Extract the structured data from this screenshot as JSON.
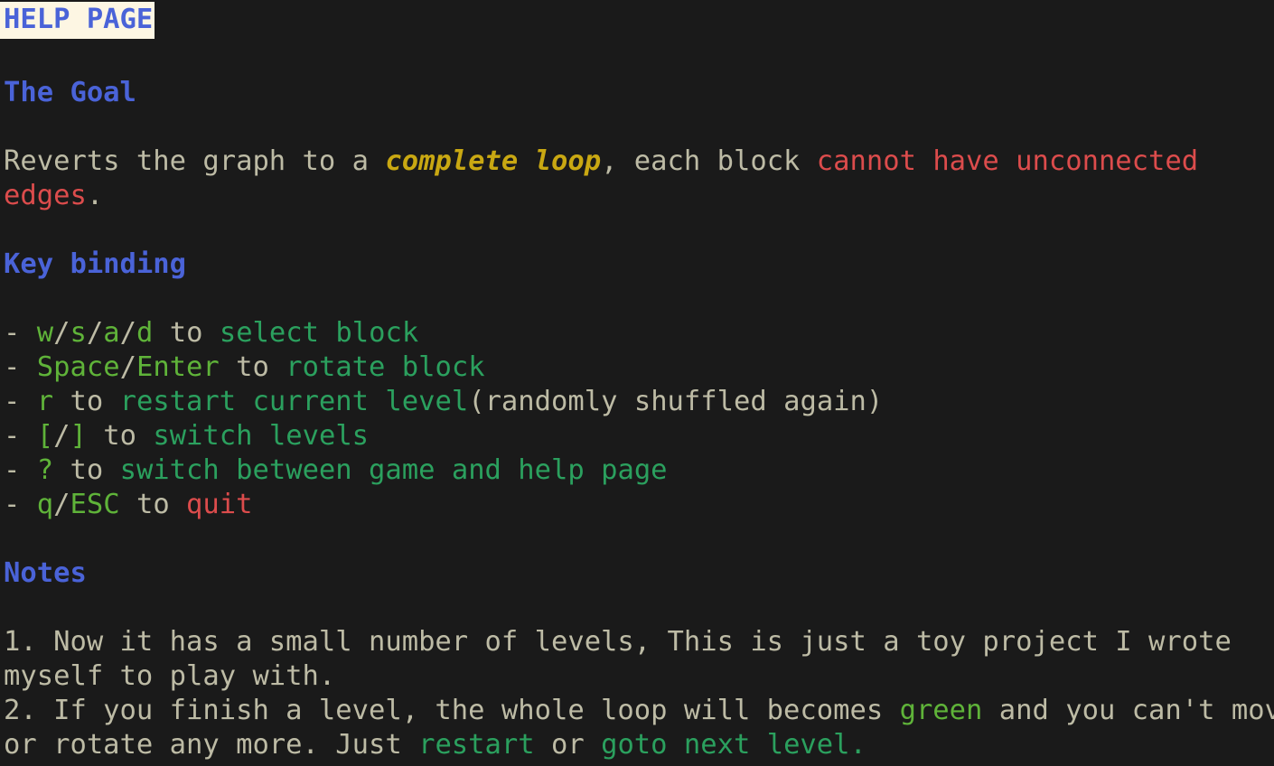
{
  "page": {
    "title": "HELP PAGE",
    "colors": {
      "background": "#1a1a1a",
      "body_text": "#bdbba5",
      "heading_blue": "#4a63d8",
      "title_highlight_bg": "#fdf6e3",
      "red": "#dc4c4c",
      "gold": "#c9a812",
      "lime_green": "#5fb339",
      "teal_green": "#2ba05e"
    }
  },
  "goal": {
    "heading": "The Goal",
    "text_1": "Reverts the graph to a ",
    "emphasis": "complete loop",
    "text_2": ", each block ",
    "warning": "cannot have unconnected edges",
    "text_3": "."
  },
  "key_binding": {
    "heading": "Key binding",
    "items": [
      {
        "bullet": "-",
        "keys": [
          "w",
          "s",
          "a",
          "d"
        ],
        "separator": "/",
        "connector": " to ",
        "action": "select block",
        "action_style": "teal",
        "suffix": ""
      },
      {
        "bullet": "-",
        "keys": [
          "Space",
          "Enter"
        ],
        "separator": "/",
        "connector": " to ",
        "action": "rotate block",
        "action_style": "teal",
        "suffix": ""
      },
      {
        "bullet": "-",
        "keys": [
          "r"
        ],
        "separator": "/",
        "connector": " to ",
        "action": "restart current level",
        "action_style": "teal",
        "suffix": "(randomly shuffled again)"
      },
      {
        "bullet": "-",
        "keys": [
          "[",
          "]"
        ],
        "separator": "/",
        "connector": " to ",
        "action": "switch levels",
        "action_style": "teal",
        "suffix": ""
      },
      {
        "bullet": "-",
        "keys": [
          "?"
        ],
        "separator": "/",
        "connector": " to ",
        "action": "switch between game and help page",
        "action_style": "teal",
        "suffix": ""
      },
      {
        "bullet": "-",
        "keys": [
          "q",
          "ESC"
        ],
        "separator": "/",
        "connector": " to ",
        "action": "quit",
        "action_style": "red",
        "suffix": ""
      }
    ]
  },
  "notes": {
    "heading": "Notes",
    "note_1": "1. Now it has a small number of levels, This is just a toy project I wrote myself to play with.",
    "note_2_part_1": "2. If you finish a level, the whole loop will becomes ",
    "note_2_green": "green",
    "note_2_part_2": " and you can't move or rotate any more. Just ",
    "note_2_restart": "restart",
    "note_2_part_3": " or ",
    "note_2_goto": "goto next level.",
    "note_2_line1_a": "2. If you finish a level, the whole loop will becomes ",
    "note_2_line1_b": " and you can't move",
    "note_2_line2_a": "or rotate any more. Just ",
    "note_2_line2_b": " or ",
    "note_2_line2_c": "goto next level."
  }
}
